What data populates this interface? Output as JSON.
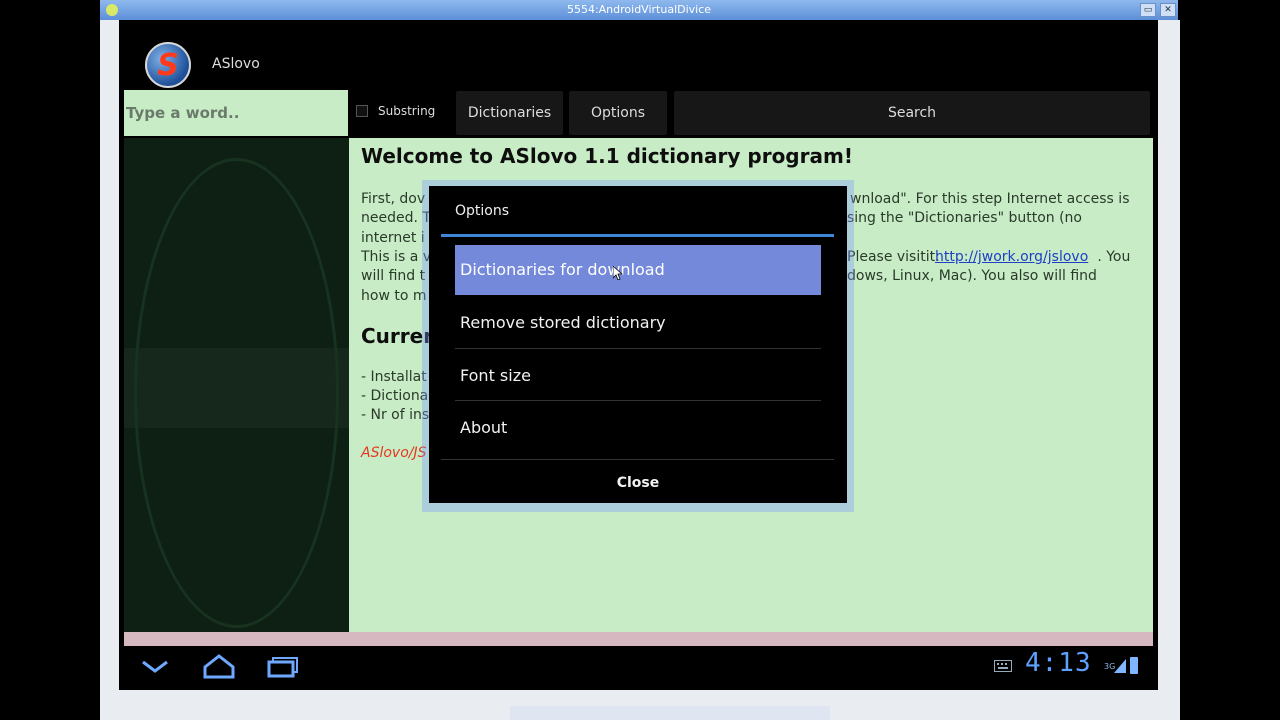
{
  "host": {
    "window_title": "5554:AndroidVirtualDivice",
    "min_glyph": "▭",
    "close_glyph": "✕"
  },
  "app": {
    "title": "ASlovo",
    "logo_glyph": "S"
  },
  "toolbar": {
    "word_placeholder": "Type a word..",
    "substring_label": "Substring",
    "dictionaries_label": "Dictionaries",
    "options_label": "Options",
    "search_label": "Search"
  },
  "content": {
    "welcome": "Welcome to ASlovo 1.1 dictionary program!",
    "p1_line1": "First, dov",
    "p1_line2": "needed. T",
    "p1_line3": "internet i",
    "p2_line1": "This is a v",
    "p2_line2": "will find t",
    "p2_line3": "how to m",
    "right1_line1": "wnload\". For this step Internet access is",
    "right1_line2": "sing the \"Dictionaries\" button (no",
    "right2_line1_prefix": "Please visitit: ",
    "link": "http://jwork.org/jslovo",
    "right2_line1_suffix": ". You",
    "right2_line2": "dows, Linux, Mac). You also will find",
    "current": "Curren",
    "bullet1": "- Installat",
    "bullet2": "- Dictiona",
    "bullet3": "- Nr of ins",
    "footer": "ASlovo/JS"
  },
  "dialog": {
    "title": "Options",
    "items": [
      "Dictionaries for download",
      "Remove stored dictionary",
      "Font size",
      "About"
    ],
    "selected_index": 0,
    "close_label": "Close"
  },
  "status": {
    "clock": "4:13",
    "network": "3G"
  },
  "colors": {
    "accent": "#3f86d6",
    "selected_item": "#7489da",
    "content_bg": "#c8ecc6",
    "clock": "#5ea0ff"
  }
}
